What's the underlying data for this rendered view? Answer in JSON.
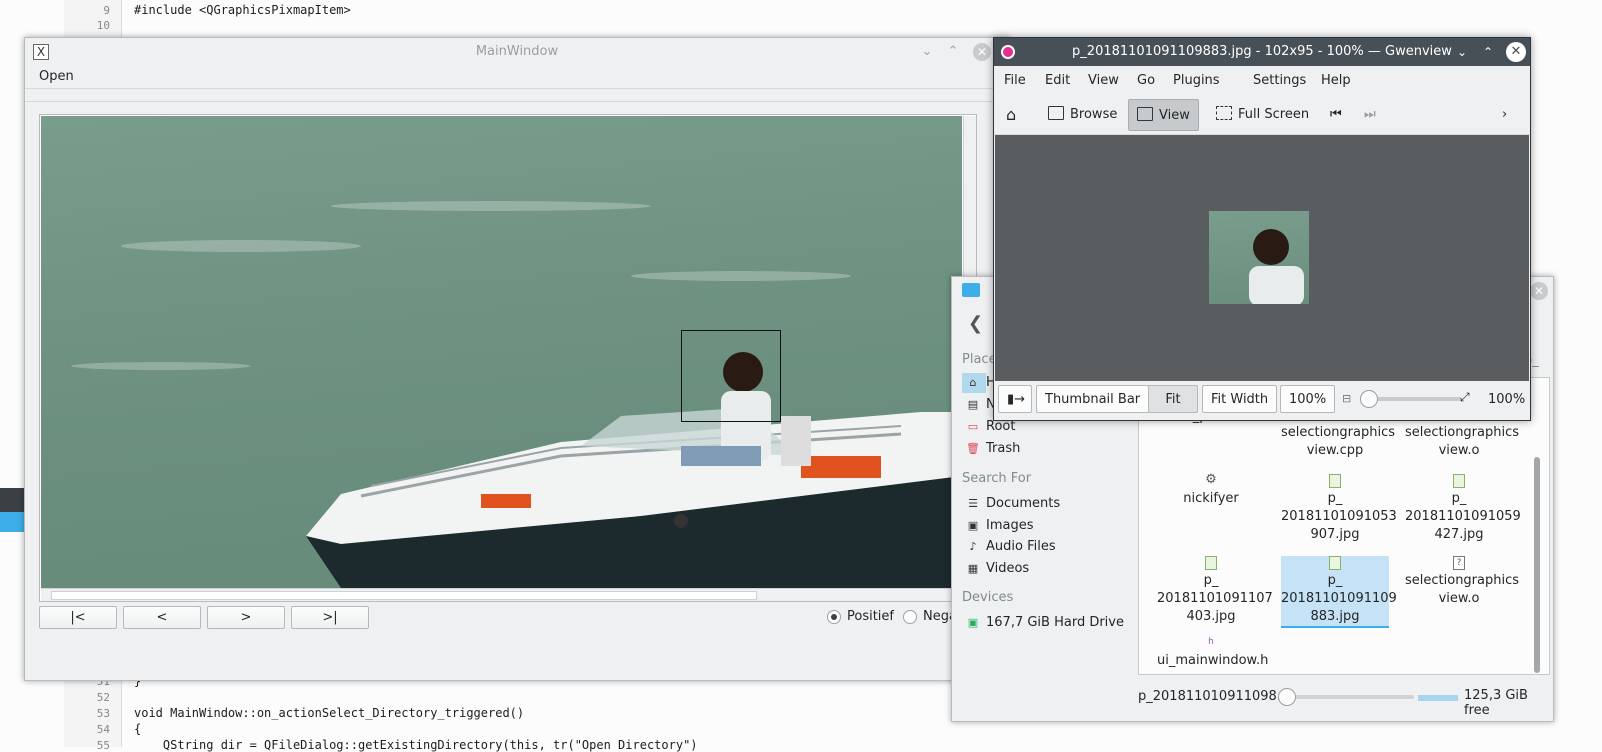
{
  "editor": {
    "lines": [
      {
        "num": "9",
        "text": "#include <QGraphicsPixmapItem>"
      },
      {
        "num": "10",
        "text": ""
      },
      {
        "num": "51",
        "text": "}"
      },
      {
        "num": "52",
        "text": ""
      },
      {
        "num": "53",
        "text": "void MainWindow::on_actionSelect_Directory_triggered()"
      },
      {
        "num": "54",
        "text": "{"
      },
      {
        "num": "55",
        "text": "    QString dir = QFileDialog::getExistingDirectory(this, tr(\"Open Directory\")"
      }
    ]
  },
  "main_window": {
    "title": "MainWindow",
    "menu_open": "Open",
    "nav_first": "|<",
    "nav_prev": "<",
    "nav_next": ">",
    "nav_last": ">|",
    "radio_positive": "Positief",
    "radio_negative": "Nega"
  },
  "gwenview": {
    "title": "p_20181101091109883.jpg - 102x95 - 100% — Gwenview",
    "menu": [
      "File",
      "Edit",
      "View",
      "Go",
      "Plugins",
      "Settings",
      "Help"
    ],
    "toolbar": {
      "browse": "Browse",
      "view": "View",
      "fullscreen": "Full Screen"
    },
    "bottom": {
      "thumbnail_bar": "Thumbnail Bar",
      "fit": "Fit",
      "fit_width": "Fit Width",
      "zoom_box": "100%",
      "zoom_label": "100%"
    },
    "accent": "#e82d91"
  },
  "file_manager": {
    "places_header": "Place",
    "places": [
      "H",
      "N",
      "Root",
      "Trash"
    ],
    "search_header": "Search For",
    "search": [
      "Documents",
      "Images",
      "Audio Files",
      "Videos"
    ],
    "devices_header": "Devices",
    "devices": [
      "167,7 GiB Hard Drive"
    ],
    "right_edge_text": "p_",
    "files": [
      {
        "name": "mos_predictin",
        "icon": "cpp"
      },
      {
        "name": "selectiongraphics view.cpp",
        "icon": "cpp"
      },
      {
        "name": "selectiongraphics view.o",
        "icon": "obj"
      },
      {
        "name": "nickifyer",
        "icon": "gear"
      },
      {
        "name": "p_ 20181101091053 907.jpg",
        "icon": "img"
      },
      {
        "name": "p_ 20181101091059 427.jpg",
        "icon": "img"
      },
      {
        "name": "p_ 20181101091107 403.jpg",
        "icon": "img"
      },
      {
        "name": "p_ 20181101091109 883.jpg",
        "icon": "img"
      },
      {
        "name": "selectiongraphics view.o",
        "icon": "obj"
      },
      {
        "name": "ui_mainwindow.h",
        "icon": "h"
      }
    ],
    "status_file": "p_201811010911098...",
    "free_space": "125,3 GiB free",
    "accent": "#3daee9"
  }
}
